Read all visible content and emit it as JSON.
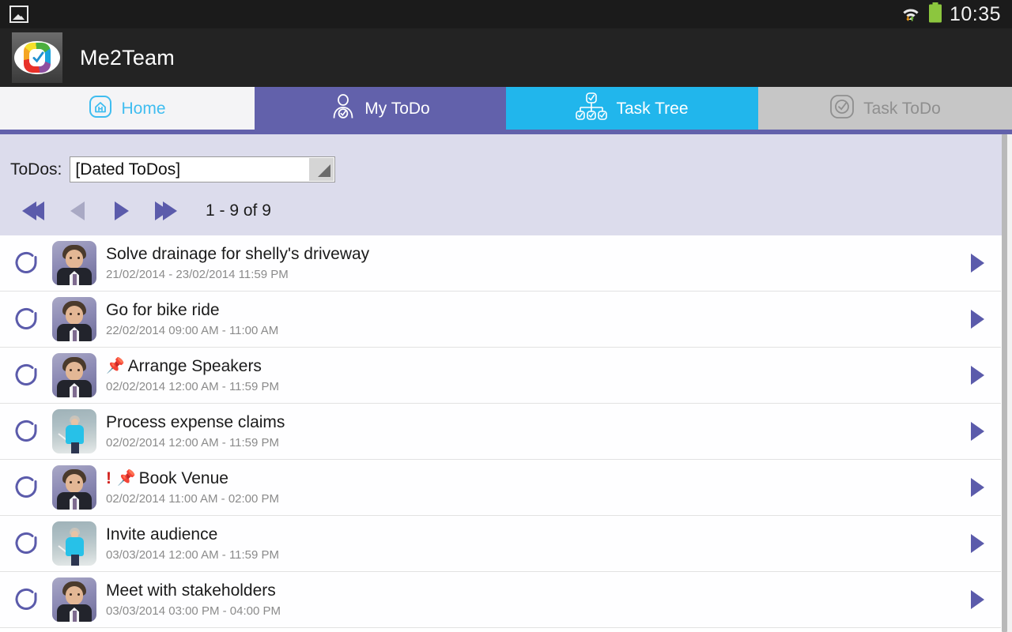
{
  "statusbar": {
    "image_icon": "image-icon",
    "wifi_icon": "wifi-icon",
    "battery_icon": "battery-icon",
    "time": "10:35"
  },
  "appbar": {
    "logo": "me2team-logo",
    "title": "Me2Team"
  },
  "tabs": [
    {
      "label": "Home",
      "icon": "home-icon",
      "state": "inactive-light"
    },
    {
      "label": "My ToDo",
      "icon": "person-check-icon",
      "state": "active-purple"
    },
    {
      "label": "Task Tree",
      "icon": "task-tree-icon",
      "state": "active-cyan"
    },
    {
      "label": "Task ToDo",
      "icon": "check-circle-icon",
      "state": "disabled"
    }
  ],
  "filter": {
    "label": "ToDos:",
    "selected": "[Dated ToDos]",
    "dropdown_icon": "dropdown-triangle-icon"
  },
  "pager": {
    "first_icon": "first-page-icon",
    "prev_icon": "previous-page-icon",
    "next_icon": "next-page-icon",
    "last_icon": "last-page-icon",
    "count": "1 - 9 of 9"
  },
  "add_button": {
    "icon": "add-todo-icon"
  },
  "list": {
    "rows": [
      {
        "status_icon": "pending-circle-icon",
        "avatar": "man",
        "priority": "",
        "pin": "",
        "title": "Solve drainage for shelly's driveway",
        "date": "21/02/2014 - 23/02/2014 11:59 PM",
        "chevron": "chevron-right-icon"
      },
      {
        "status_icon": "pending-circle-icon",
        "avatar": "man",
        "priority": "",
        "pin": "",
        "title": "Go for bike ride",
        "date": "22/02/2014 09:00 AM - 11:00 AM",
        "chevron": "chevron-right-icon"
      },
      {
        "status_icon": "pending-circle-icon",
        "avatar": "man",
        "priority": "",
        "pin": "📌",
        "title": "Arrange Speakers",
        "date": "02/02/2014 12:00 AM - 11:59 PM",
        "chevron": "chevron-right-icon"
      },
      {
        "status_icon": "pending-circle-icon",
        "avatar": "woman",
        "priority": "",
        "pin": "",
        "title": "Process expense claims",
        "date": "02/02/2014 12:00 AM - 11:59 PM",
        "chevron": "chevron-right-icon"
      },
      {
        "status_icon": "pending-circle-icon",
        "avatar": "man",
        "priority": "!",
        "pin": "📌",
        "title": "Book Venue",
        "date": "02/02/2014 11:00 AM - 02:00 PM",
        "chevron": "chevron-right-icon"
      },
      {
        "status_icon": "pending-circle-icon",
        "avatar": "woman",
        "priority": "",
        "pin": "",
        "title": "Invite audience",
        "date": "03/03/2014 12:00 AM - 11:59 PM",
        "chevron": "chevron-right-icon"
      },
      {
        "status_icon": "pending-circle-icon",
        "avatar": "man",
        "priority": "",
        "pin": "",
        "title": "Meet with stakeholders",
        "date": "03/03/2014 03:00 PM - 04:00 PM",
        "chevron": "chevron-right-icon"
      }
    ]
  },
  "colors": {
    "purple": "#6261ab",
    "cyan": "#21b6ec",
    "tab_disabled": "#c6c6c6",
    "filter_bg": "#dcdcec",
    "status_bar": "#1b1b1b",
    "app_bar": "#232323",
    "accent_text_cyan": "#3fbdf0",
    "priority_red": "#d2231f"
  }
}
